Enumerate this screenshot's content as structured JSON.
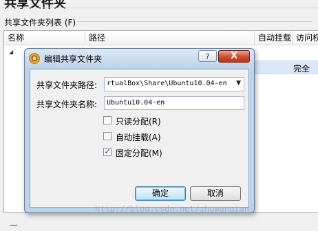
{
  "page": {
    "title": "共享文件夹",
    "list_label": "共享文件夹列表 (F)",
    "columns": [
      "名称",
      "路径",
      "自动挂载",
      "访问权"
    ],
    "row_access": "完全",
    "bottom_text": "一"
  },
  "dialog": {
    "title": "编辑共享文件夹",
    "help_label": "?",
    "close_label": "X",
    "path_label": "共享文件夹路径:",
    "path_value": "rtualBox\\Share\\Ubuntu10.04-en",
    "name_label": "共享文件夹名称:",
    "name_value": "Ubuntu10.04-en",
    "checkboxes": [
      {
        "label": "只读分配(R)",
        "checked": false
      },
      {
        "label": "自动挂载(A)",
        "checked": false
      },
      {
        "label": "固定分配(M)",
        "checked": true
      }
    ],
    "ok_label": "确定",
    "cancel_label": "取消"
  },
  "watermark": "http://blog.csdn.net/zhuwanqian",
  "icons": {
    "app": "gear-icon",
    "dropdown": "chevron-down-icon",
    "tree_toggle": "collapse-triangle-icon",
    "check": "checkmark-icon"
  }
}
